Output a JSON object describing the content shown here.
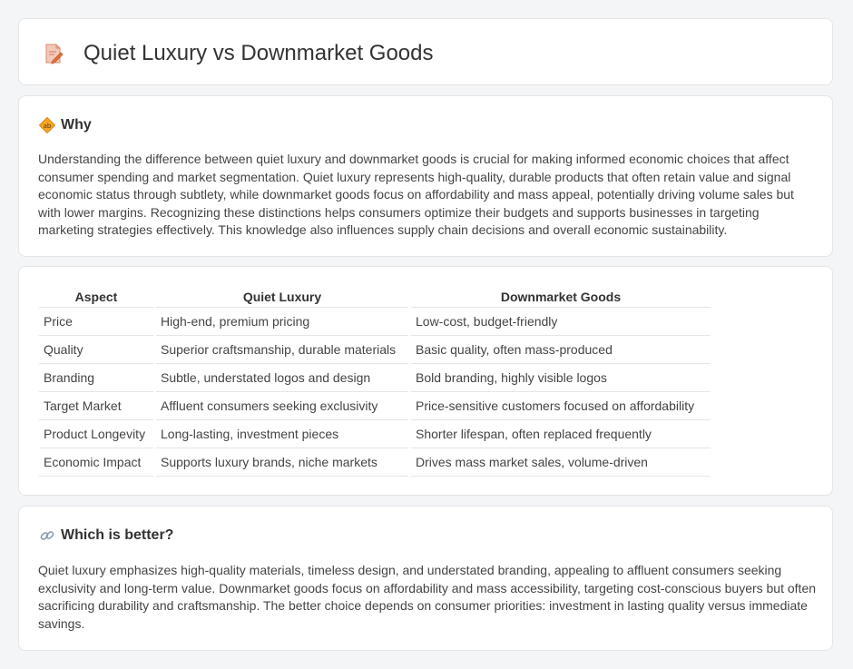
{
  "header": {
    "title": "Quiet Luxury vs Downmarket Goods",
    "icon": "document-pencil-icon"
  },
  "why": {
    "heading": "Why",
    "icon": "diamond-sign-icon",
    "text": "Understanding the difference between quiet luxury and downmarket goods is crucial for making informed economic choices that affect consumer spending and market segmentation. Quiet luxury represents high-quality, durable products that often retain value and signal economic status through subtlety, while downmarket goods focus on affordability and mass appeal, potentially driving volume sales but with lower margins. Recognizing these distinctions helps consumers optimize their budgets and supports businesses in targeting marketing strategies effectively. This knowledge also influences supply chain decisions and overall economic sustainability."
  },
  "table": {
    "headers": [
      "Aspect",
      "Quiet Luxury",
      "Downmarket Goods"
    ],
    "rows": [
      [
        "Price",
        "High-end, premium pricing",
        "Low-cost, budget-friendly"
      ],
      [
        "Quality",
        "Superior craftsmanship, durable materials",
        "Basic quality, often mass-produced"
      ],
      [
        "Branding",
        "Subtle, understated logos and design",
        "Bold branding, highly visible logos"
      ],
      [
        "Target Market",
        "Affluent consumers seeking exclusivity",
        "Price-sensitive customers focused on affordability"
      ],
      [
        "Product Longevity",
        "Long-lasting, investment pieces",
        "Shorter lifespan, often replaced frequently"
      ],
      [
        "Economic Impact",
        "Supports luxury brands, niche markets",
        "Drives mass market sales, volume-driven"
      ]
    ]
  },
  "better": {
    "heading": "Which is better?",
    "icon": "link-icon",
    "text": "Quiet luxury emphasizes high-quality materials, timeless design, and understated branding, appealing to affluent consumers seeking exclusivity and long-term value. Downmarket goods focus on affordability and mass accessibility, targeting cost-conscious buyers but often sacrificing durability and craftsmanship. The better choice depends on consumer priorities: investment in lasting quality versus immediate savings."
  }
}
